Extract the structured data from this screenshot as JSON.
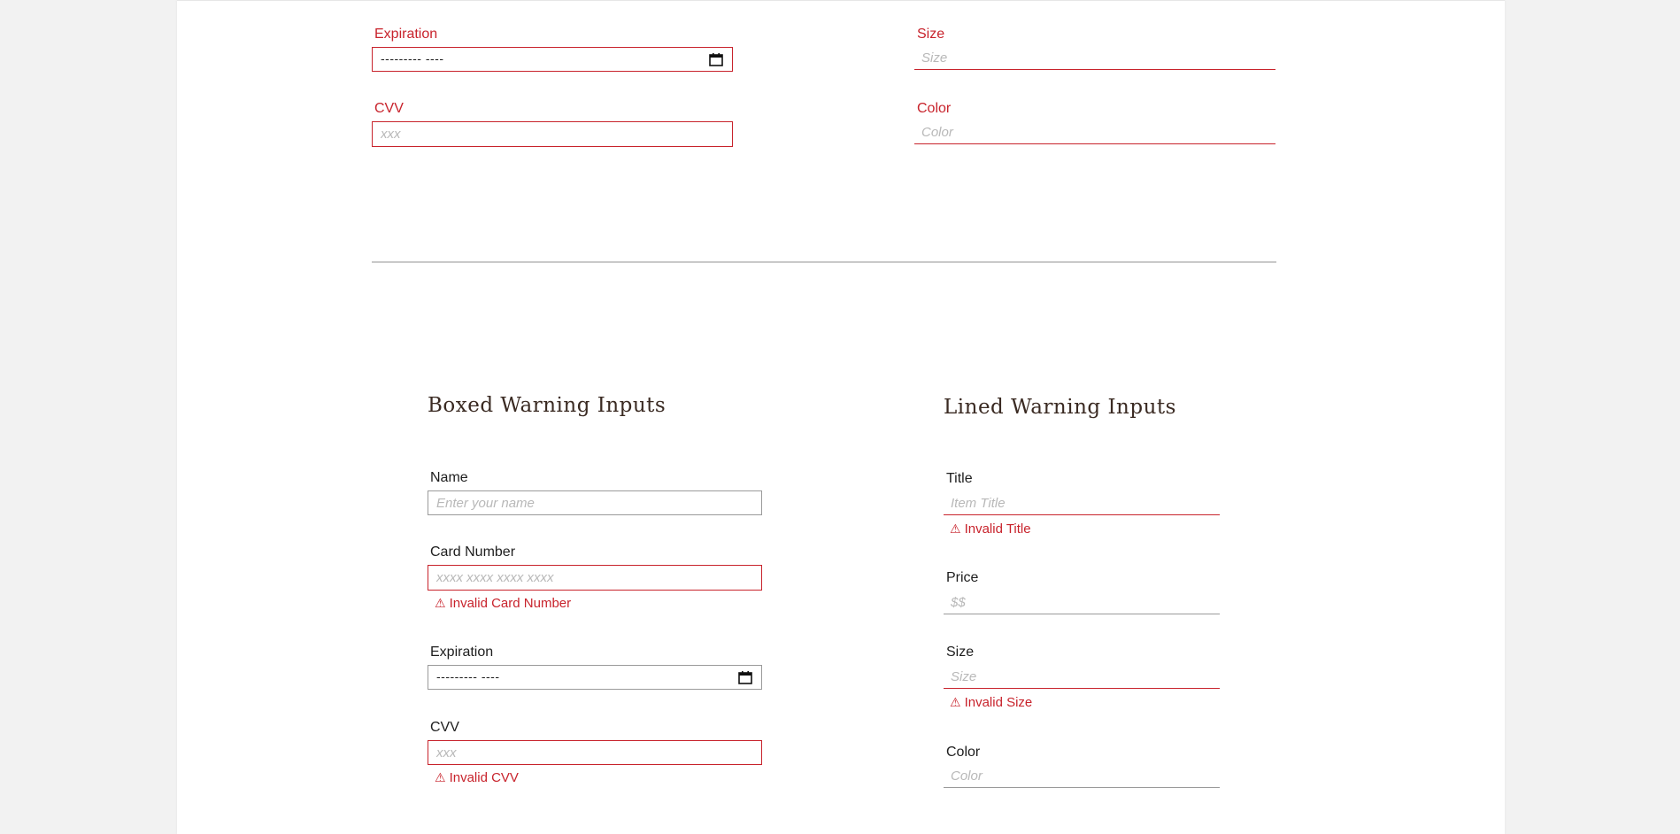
{
  "top_section": {
    "boxed": {
      "expiration": {
        "label": "Expiration",
        "value": "--------- ----"
      },
      "cvv": {
        "label": "CVV",
        "placeholder": "xxx"
      }
    },
    "lined": {
      "size": {
        "label": "Size",
        "placeholder": "Size"
      },
      "color": {
        "label": "Color",
        "placeholder": "Color"
      }
    }
  },
  "boxed_warning": {
    "heading": "Boxed Warning Inputs",
    "name": {
      "label": "Name",
      "placeholder": "Enter your name"
    },
    "card_number": {
      "label": "Card Number",
      "placeholder": "xxxx xxxx xxxx xxxx",
      "error": "Invalid Card Number"
    },
    "expiration": {
      "label": "Expiration",
      "value": "--------- ----"
    },
    "cvv": {
      "label": "CVV",
      "placeholder": "xxx",
      "error": "Invalid CVV"
    }
  },
  "lined_warning": {
    "heading": "Lined Warning Inputs",
    "title": {
      "label": "Title",
      "placeholder": "Item Title",
      "error": "Invalid Title"
    },
    "price": {
      "label": "Price",
      "placeholder": "$$"
    },
    "size": {
      "label": "Size",
      "placeholder": "Size",
      "error": "Invalid Size"
    },
    "color": {
      "label": "Color",
      "placeholder": "Color"
    }
  },
  "icons": {
    "warning": "⚠",
    "calendar": "calendar-icon"
  },
  "colors": {
    "error_red": "#c8232c",
    "neutral_border": "#9a9a9a",
    "heading_brown": "#3a2a22",
    "background": "#f2f2f2"
  }
}
